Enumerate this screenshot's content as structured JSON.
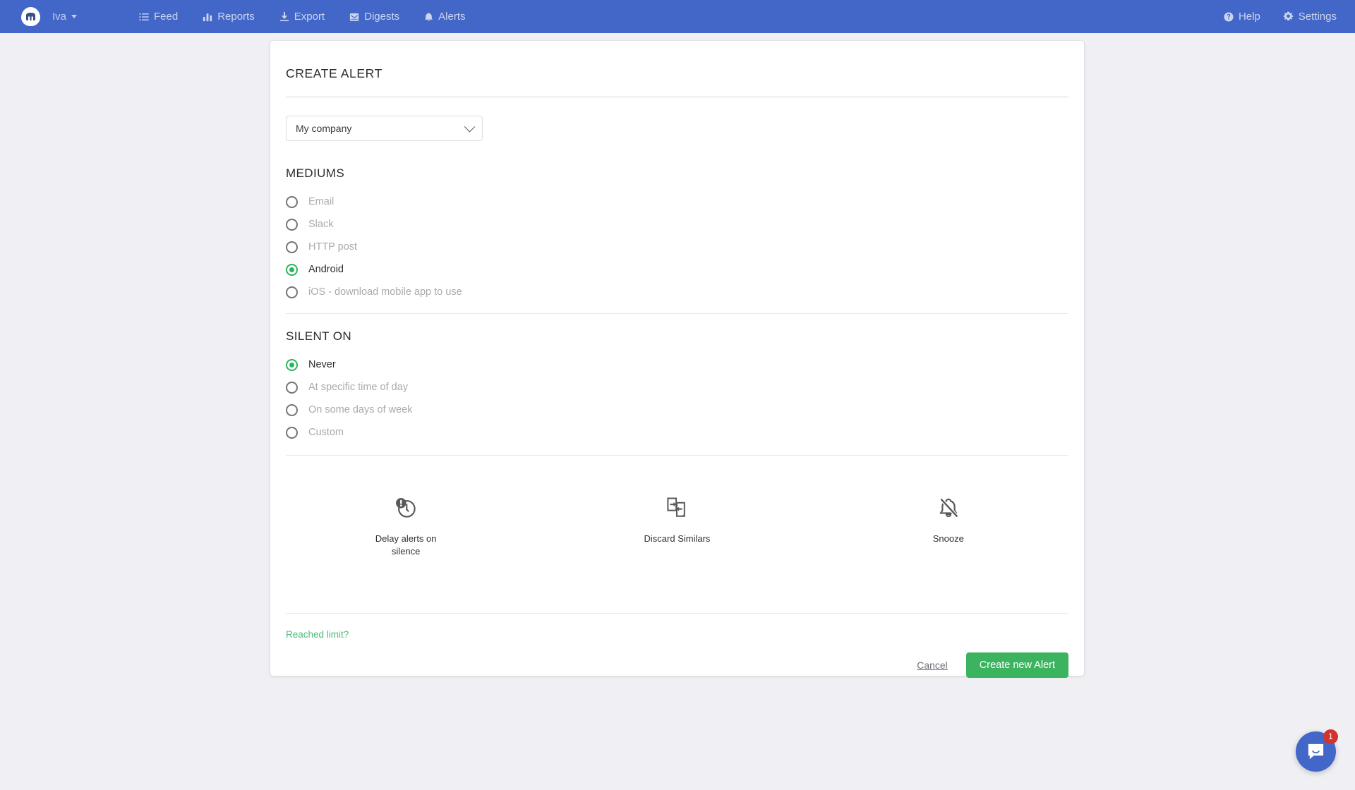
{
  "navbar": {
    "brand": "Iva",
    "logo_icon": "iva-shield-logo",
    "brand_caret_icon": "chevron-down-icon",
    "items": [
      {
        "label": "Feed",
        "icon": "list-icon"
      },
      {
        "label": "Reports",
        "icon": "bar-chart-icon"
      },
      {
        "label": "Export",
        "icon": "download-icon"
      },
      {
        "label": "Digests",
        "icon": "envelope-icon"
      },
      {
        "label": "Alerts",
        "icon": "bell-icon"
      }
    ],
    "right_items": [
      {
        "label": "Help",
        "icon": "help-circle-icon"
      },
      {
        "label": "Settings",
        "icon": "gear-icon"
      }
    ],
    "background_color": "#4367c8",
    "text_color": "#ccd6f0"
  },
  "card": {
    "title": "CREATE ALERT",
    "company_select": {
      "value": "My company",
      "chevron_icon": "chevron-down-icon"
    },
    "mediums": {
      "title": "MEDIUMS",
      "options": [
        {
          "label": "Email",
          "selected": false
        },
        {
          "label": "Slack",
          "selected": false
        },
        {
          "label": "HTTP post",
          "selected": false
        },
        {
          "label": "Android",
          "selected": true
        },
        {
          "label": "iOS - download mobile app to use",
          "selected": false
        }
      ]
    },
    "silent_on": {
      "title": "SILENT ON",
      "options": [
        {
          "label": "Never",
          "selected": true
        },
        {
          "label": "At specific time of day",
          "selected": false
        },
        {
          "label": "On some days of week",
          "selected": false
        },
        {
          "label": "Custom",
          "selected": false
        }
      ]
    },
    "features": [
      {
        "label": "Delay alerts on silence",
        "icon": "clock-alert-icon"
      },
      {
        "label": "Discard Similars",
        "icon": "duplicate-pages-icon"
      },
      {
        "label": "Snooze",
        "icon": "bell-off-icon"
      }
    ],
    "limit_link": "Reached limit?",
    "cancel_label": "Cancel",
    "submit_label": "Create new Alert"
  },
  "chat": {
    "badge_count": "1",
    "icon": "chat-bubble-icon"
  },
  "colors": {
    "accent_blue": "#4367c8",
    "accent_green": "#3cb45f",
    "badge_red": "#d0342c",
    "page_background": "#f0f0f4"
  }
}
